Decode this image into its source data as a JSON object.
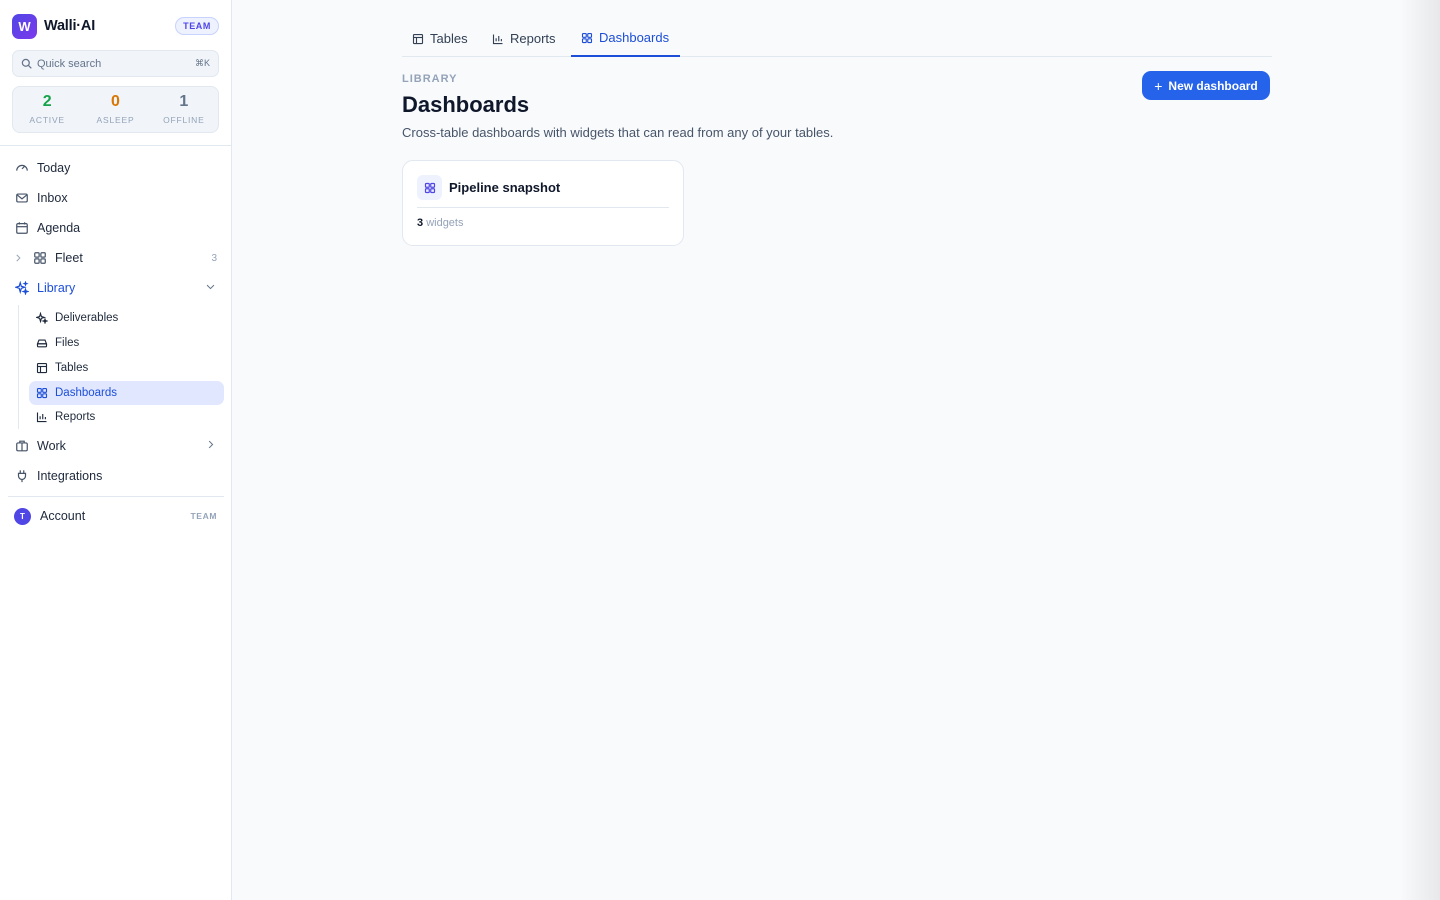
{
  "brand": {
    "logo_letter": "W",
    "name": "Walli·AI",
    "plan_badge": "TEAM"
  },
  "search": {
    "placeholder": "Quick search",
    "shortcut": "⌘K"
  },
  "stats": [
    {
      "value": "2",
      "label": "ACTIVE",
      "color": "#16a34a"
    },
    {
      "value": "0",
      "label": "ASLEEP",
      "color": "#d97706"
    },
    {
      "value": "1",
      "label": "OFFLINE",
      "color": "#64748b"
    }
  ],
  "nav": {
    "today": "Today",
    "inbox": "Inbox",
    "agenda": "Agenda",
    "fleet": "Fleet",
    "fleet_count": "3",
    "library": "Library",
    "library_sub": {
      "deliverables": "Deliverables",
      "files": "Files",
      "tables": "Tables",
      "dashboards": "Dashboards",
      "reports": "Reports"
    },
    "work": "Work",
    "integrations": "Integrations"
  },
  "account": {
    "initial": "T",
    "label": "Account",
    "tag": "TEAM"
  },
  "tabs": [
    "Tables",
    "Reports",
    "Dashboards"
  ],
  "page": {
    "eyebrow": "LIBRARY",
    "title": "Dashboards",
    "description": "Cross-table dashboards with widgets that can read from any of your tables.",
    "new_button": "New dashboard"
  },
  "dashboards": [
    {
      "title": "Pipeline snapshot",
      "widget_count": "3",
      "widget_label": "widgets"
    }
  ],
  "colors": {
    "accent": "#2563eb",
    "brand": "#4f46e5"
  }
}
